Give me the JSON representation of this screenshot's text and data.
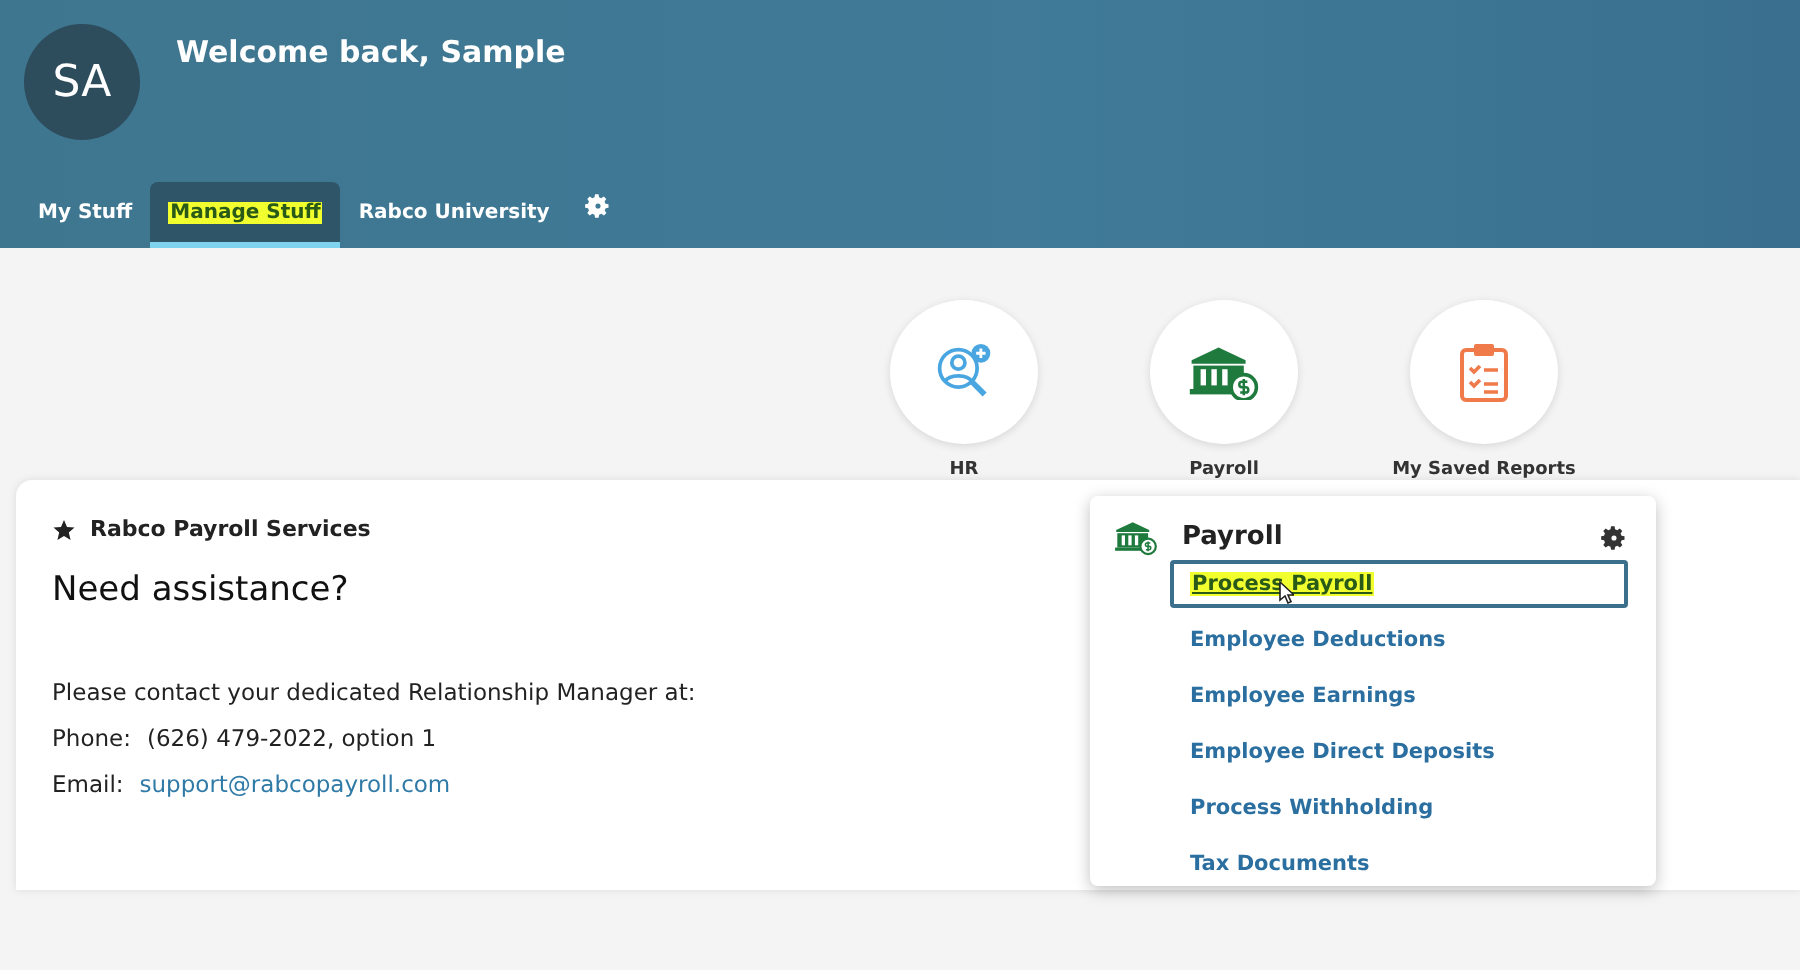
{
  "header": {
    "avatar_initials": "SA",
    "greeting": "Welcome back, Sample"
  },
  "tabs": [
    {
      "label": "My Stuff",
      "selected": false,
      "highlighted": false
    },
    {
      "label": "Manage Stuff",
      "selected": true,
      "highlighted": true
    },
    {
      "label": "Rabco University",
      "selected": false,
      "highlighted": false
    }
  ],
  "tiles": [
    {
      "label": "HR",
      "kind": "hr"
    },
    {
      "label": "Payroll",
      "kind": "payroll"
    },
    {
      "label": "My Saved Reports",
      "kind": "reports"
    }
  ],
  "card": {
    "title": "Rabco Payroll Services",
    "heading": "Need assistance?",
    "intro": "Please contact your dedicated Relationship Manager at:",
    "phone_label": "Phone:",
    "phone": "(626) 479-2022, option 1",
    "email_label": "Email:",
    "email": "support@rabcopayroll.com"
  },
  "payroll_menu": {
    "title": "Payroll",
    "items": [
      {
        "label": "Process Payroll",
        "selected": true,
        "highlighted": true
      },
      {
        "label": "Employee Deductions",
        "selected": false,
        "highlighted": false
      },
      {
        "label": "Employee Earnings",
        "selected": false,
        "highlighted": false
      },
      {
        "label": "Employee Direct Deposits",
        "selected": false,
        "highlighted": false
      },
      {
        "label": "Process Withholding",
        "selected": false,
        "highlighted": false
      },
      {
        "label": "Tax Documents",
        "selected": false,
        "highlighted": false
      }
    ]
  }
}
